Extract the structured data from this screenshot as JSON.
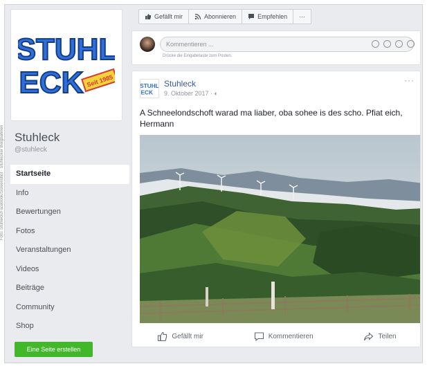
{
  "caption": "Foto: Stuhleck/Facebook/Screenshot · Stuhlecker Bergbahnen",
  "page": {
    "logo_text_top": "STUHL",
    "logo_text_bottom": "ECK",
    "logo_badge": "Seit 1985",
    "name": "Stuhleck",
    "handle": "@stuhleck"
  },
  "nav": [
    {
      "label": "Startseite",
      "active": true
    },
    {
      "label": "Info"
    },
    {
      "label": "Bewertungen"
    },
    {
      "label": "Fotos"
    },
    {
      "label": "Veranstaltungen"
    },
    {
      "label": "Videos"
    },
    {
      "label": "Beiträge"
    },
    {
      "label": "Community"
    },
    {
      "label": "Shop"
    }
  ],
  "create_page_label": "Eine Seite erstellen",
  "actions": {
    "like": "Gefällt mir",
    "follow": "Abonnieren",
    "recommend": "Empfehlen",
    "more": "···"
  },
  "composer": {
    "placeholder": "Kommentieren ...",
    "hint": "Drücke die Eingabetaste zum Posten."
  },
  "post": {
    "author": "Stuhleck",
    "meta": "9. Oktober 2017 · ◐",
    "more": "···",
    "text": "A Schneelondschoft warad ma liaber, oba sohee is des scho. Pfiat eich, Hermann",
    "like_label": "Gefällt mir",
    "comment_label": "Kommentieren",
    "share_label": "Teilen"
  },
  "colors": {
    "background": "#e9ebee",
    "link": "#385898",
    "green_button": "#42b72a",
    "logo_blue": "#2f6fd6"
  }
}
